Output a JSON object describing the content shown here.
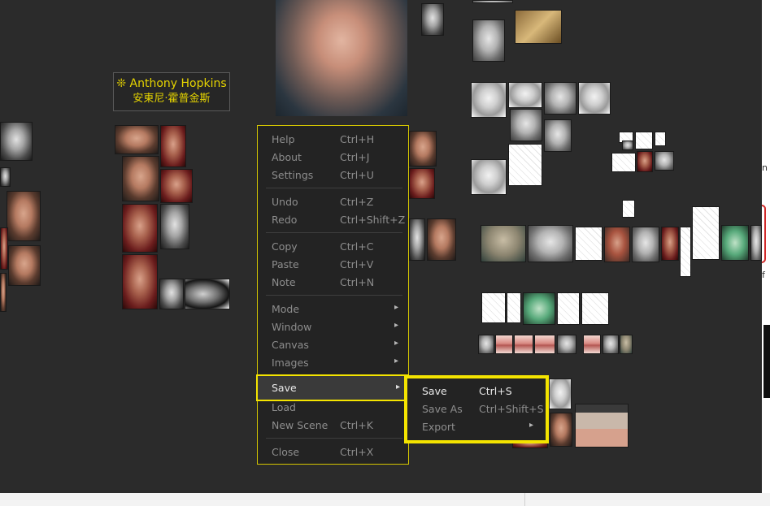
{
  "nameplate": {
    "title": "❊ Anthony Hopkins",
    "subtitle": "安東尼·霍普金斯"
  },
  "context_menu": {
    "items": [
      {
        "label": "Help",
        "shortcut": "Ctrl+H"
      },
      {
        "label": "About",
        "shortcut": "Ctrl+J"
      },
      {
        "label": "Settings",
        "shortcut": "Ctrl+U"
      },
      {
        "label": "Undo",
        "shortcut": "Ctrl+Z"
      },
      {
        "label": "Redo",
        "shortcut": "Ctrl+Shift+Z"
      },
      {
        "label": "Copy",
        "shortcut": "Ctrl+C"
      },
      {
        "label": "Paste",
        "shortcut": "Ctrl+V"
      },
      {
        "label": "Note",
        "shortcut": "Ctrl+N"
      },
      {
        "label": "Mode",
        "shortcut": ""
      },
      {
        "label": "Window",
        "shortcut": ""
      },
      {
        "label": "Canvas",
        "shortcut": ""
      },
      {
        "label": "Images",
        "shortcut": ""
      },
      {
        "label": "Save",
        "shortcut": ""
      },
      {
        "label": "Load",
        "shortcut": ""
      },
      {
        "label": "New Scene",
        "shortcut": "Ctrl+K"
      },
      {
        "label": "Close",
        "shortcut": "Ctrl+X"
      }
    ],
    "submenu_arrow": "▸"
  },
  "save_submenu": {
    "items": [
      {
        "label": "Save",
        "shortcut": "Ctrl+S"
      },
      {
        "label": "Save As",
        "shortcut": "Ctrl+Shift+S"
      },
      {
        "label": "Export",
        "shortcut": ""
      }
    ]
  },
  "edge_glyphs": {
    "g1": "n",
    "g2": "f"
  },
  "colors": {
    "canvas_bg": "#2b2b2b",
    "menu_bg": "#232323",
    "highlight_yellow": "#f4e400",
    "nameplate_text": "#e6d400"
  }
}
